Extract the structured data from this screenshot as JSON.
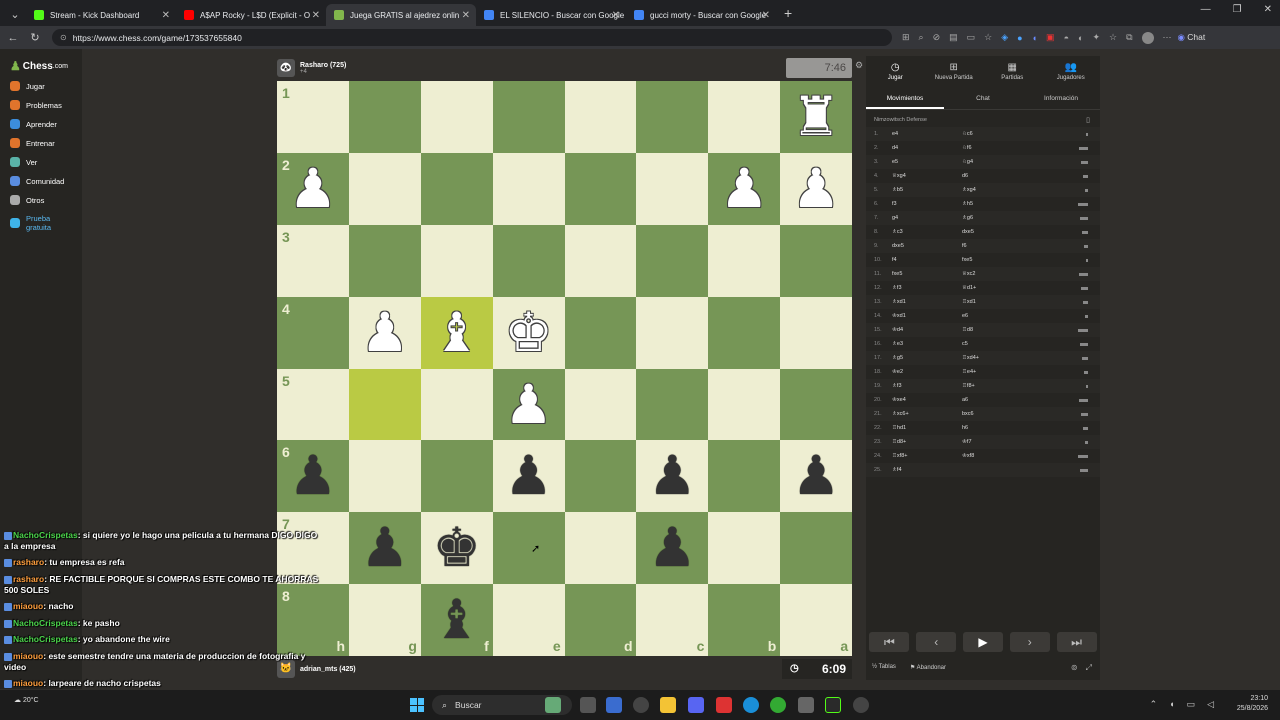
{
  "browser": {
    "tabs": [
      {
        "title": "Stream - Kick Dashboard",
        "color": "#53fc18",
        "active": false
      },
      {
        "title": "A$AP Rocky - L$D (Explicit - O",
        "color": "#ff0000",
        "active": false
      },
      {
        "title": "Juega GRATIS al ajedrez onlin",
        "color": "#81b64c",
        "active": true
      },
      {
        "title": "EL SILENCIO - Buscar con Google",
        "color": "#4285f4",
        "active": false
      },
      {
        "title": "gucci morty - Buscar con Google",
        "color": "#4285f4",
        "active": false
      }
    ],
    "new_tab": "+",
    "url": "https://www.chess.com/game/173537655840",
    "chat_button": "Chat"
  },
  "sidebar": {
    "logo": "Chess",
    "logo_suffix": ".com",
    "items": [
      {
        "label": "Jugar",
        "icon": "play-icon",
        "color": "#e0742c"
      },
      {
        "label": "Problemas",
        "icon": "puzzle-icon",
        "color": "#e0742c"
      },
      {
        "label": "Aprender",
        "icon": "learn-icon",
        "color": "#3c8ddb"
      },
      {
        "label": "Entrenar",
        "icon": "train-icon",
        "color": "#e0742c"
      },
      {
        "label": "Ver",
        "icon": "watch-icon",
        "color": "#5ab3a8"
      },
      {
        "label": "Comunidad",
        "icon": "community-icon",
        "color": "#5a8de0"
      },
      {
        "label": "Otros",
        "icon": "more-icon",
        "color": "#aaaaaa"
      },
      {
        "label": "Prueba gratuita",
        "icon": "diamond-icon",
        "color": "#3fb3e8"
      }
    ]
  },
  "game": {
    "top_player": {
      "name": "Rasharo (725)",
      "sub": "+4",
      "clock": "7:46"
    },
    "bottom_player": {
      "name": "adrian_mts (425)",
      "clock": "6:09"
    },
    "ranks": [
      "1",
      "2",
      "3",
      "4",
      "5",
      "6",
      "7",
      "8"
    ],
    "files": [
      "h",
      "g",
      "f",
      "e",
      "d",
      "c",
      "b",
      "a"
    ],
    "pieces": [
      {
        "square": "a1",
        "glyph": "♜",
        "color": "white",
        "name": "white-rook"
      },
      {
        "square": "h2",
        "glyph": "♟",
        "color": "white",
        "name": "white-pawn"
      },
      {
        "square": "b2",
        "glyph": "♟",
        "color": "white",
        "name": "white-pawn"
      },
      {
        "square": "a2",
        "glyph": "♟",
        "color": "white",
        "name": "white-pawn"
      },
      {
        "square": "g4",
        "glyph": "♟",
        "color": "white",
        "name": "white-pawn"
      },
      {
        "square": "f4",
        "glyph": "♝",
        "color": "white",
        "name": "white-bishop"
      },
      {
        "square": "e4",
        "glyph": "♚",
        "color": "white",
        "name": "white-king"
      },
      {
        "square": "e5",
        "glyph": "♟",
        "color": "white",
        "name": "white-pawn"
      },
      {
        "square": "h6",
        "glyph": "♟",
        "color": "black",
        "name": "black-pawn"
      },
      {
        "square": "e6",
        "glyph": "♟",
        "color": "black",
        "name": "black-pawn"
      },
      {
        "square": "c6",
        "glyph": "♟",
        "color": "black",
        "name": "black-pawn"
      },
      {
        "square": "a6",
        "glyph": "♟",
        "color": "black",
        "name": "black-pawn"
      },
      {
        "square": "g7",
        "glyph": "♟",
        "color": "black",
        "name": "black-pawn"
      },
      {
        "square": "f7",
        "glyph": "♚",
        "color": "black",
        "name": "black-king"
      },
      {
        "square": "c7",
        "glyph": "♟",
        "color": "black",
        "name": "black-pawn"
      },
      {
        "square": "f8",
        "glyph": "♝",
        "color": "black",
        "name": "black-bishop"
      }
    ],
    "highlights": [
      "f4",
      "g5"
    ]
  },
  "panel": {
    "tabs": [
      {
        "label": "Jugar",
        "icon": "play-icon"
      },
      {
        "label": "Nueva Partida",
        "icon": "plus-icon"
      },
      {
        "label": "Partidas",
        "icon": "games-icon"
      },
      {
        "label": "Jugadores",
        "icon": "players-icon"
      }
    ],
    "subtabs": [
      "Movimientos",
      "Chat",
      "Información"
    ],
    "opening": "Nimzowitsch Defense",
    "moves": [
      {
        "n": "1.",
        "w": "e4",
        "b": "♘c6"
      },
      {
        "n": "2.",
        "w": "d4",
        "b": "♘f6"
      },
      {
        "n": "3.",
        "w": "e5",
        "b": "♘g4"
      },
      {
        "n": "4.",
        "w": "♕xg4",
        "b": "d6"
      },
      {
        "n": "5.",
        "w": "♗b5",
        "b": "♗xg4"
      },
      {
        "n": "6.",
        "w": "f3",
        "b": "♗h5"
      },
      {
        "n": "7.",
        "w": "g4",
        "b": "♗g6"
      },
      {
        "n": "8.",
        "w": "♗c3",
        "b": "dxe5"
      },
      {
        "n": "9.",
        "w": "dxe5",
        "b": "f6"
      },
      {
        "n": "10.",
        "w": "f4",
        "b": "fxe5"
      },
      {
        "n": "11.",
        "w": "fxe5",
        "b": "♕xc2"
      },
      {
        "n": "12.",
        "w": "♗f3",
        "b": "♕d1+"
      },
      {
        "n": "13.",
        "w": "♗xd1",
        "b": "♖xd1"
      },
      {
        "n": "14.",
        "w": "♔xd1",
        "b": "e6"
      },
      {
        "n": "15.",
        "w": "♔d4",
        "b": "♖d8"
      },
      {
        "n": "16.",
        "w": "♗e3",
        "b": "c5"
      },
      {
        "n": "17.",
        "w": "♗g5",
        "b": "♖xd4+"
      },
      {
        "n": "18.",
        "w": "♔e2",
        "b": "♖e4+"
      },
      {
        "n": "19.",
        "w": "♗f3",
        "b": "♖f8+"
      },
      {
        "n": "20.",
        "w": "♔xe4",
        "b": "a6"
      },
      {
        "n": "21.",
        "w": "♗xc6+",
        "b": "bxc6"
      },
      {
        "n": "22.",
        "w": "♖hd1",
        "b": "h6"
      },
      {
        "n": "23.",
        "w": "♖d8+",
        "b": "♔f7"
      },
      {
        "n": "24.",
        "w": "♖xf8+",
        "b": "♔xf8"
      },
      {
        "n": "25.",
        "w": "♗f4",
        "b": ""
      }
    ],
    "footer": {
      "draw": "Tablas",
      "resign": "Abandonar"
    }
  },
  "stream_chat": [
    {
      "user": "NachoCrispetas",
      "text": "si quiere yo le hago una pelicula a tu hermana DIGO DIGO a la empresa",
      "kind": "g"
    },
    {
      "user": "rasharo",
      "text": "tu empresa es refa",
      "kind": "r"
    },
    {
      "user": "rasharo",
      "text": "RE FACTIBLE PORQUE SI COMPRAS ESTE COMBO TE AHORRAS 500 SOLES",
      "kind": "r"
    },
    {
      "user": "miaouo",
      "text": "nacho",
      "kind": "m"
    },
    {
      "user": "NachoCrispetas",
      "text": "ke pasho",
      "kind": "g"
    },
    {
      "user": "NachoCrispetas",
      "text": "yo abandone the wire",
      "kind": "g"
    },
    {
      "user": "miaouo",
      "text": "este semestre tendre una materia de produccion de fotografia y video",
      "kind": "m"
    },
    {
      "user": "miaouo",
      "text": "larpeare de nacho crispetas",
      "kind": "m"
    }
  ],
  "taskbar": {
    "weather": "20°C",
    "search": "Buscar",
    "time": "23:10",
    "date": "25/8/2026"
  }
}
